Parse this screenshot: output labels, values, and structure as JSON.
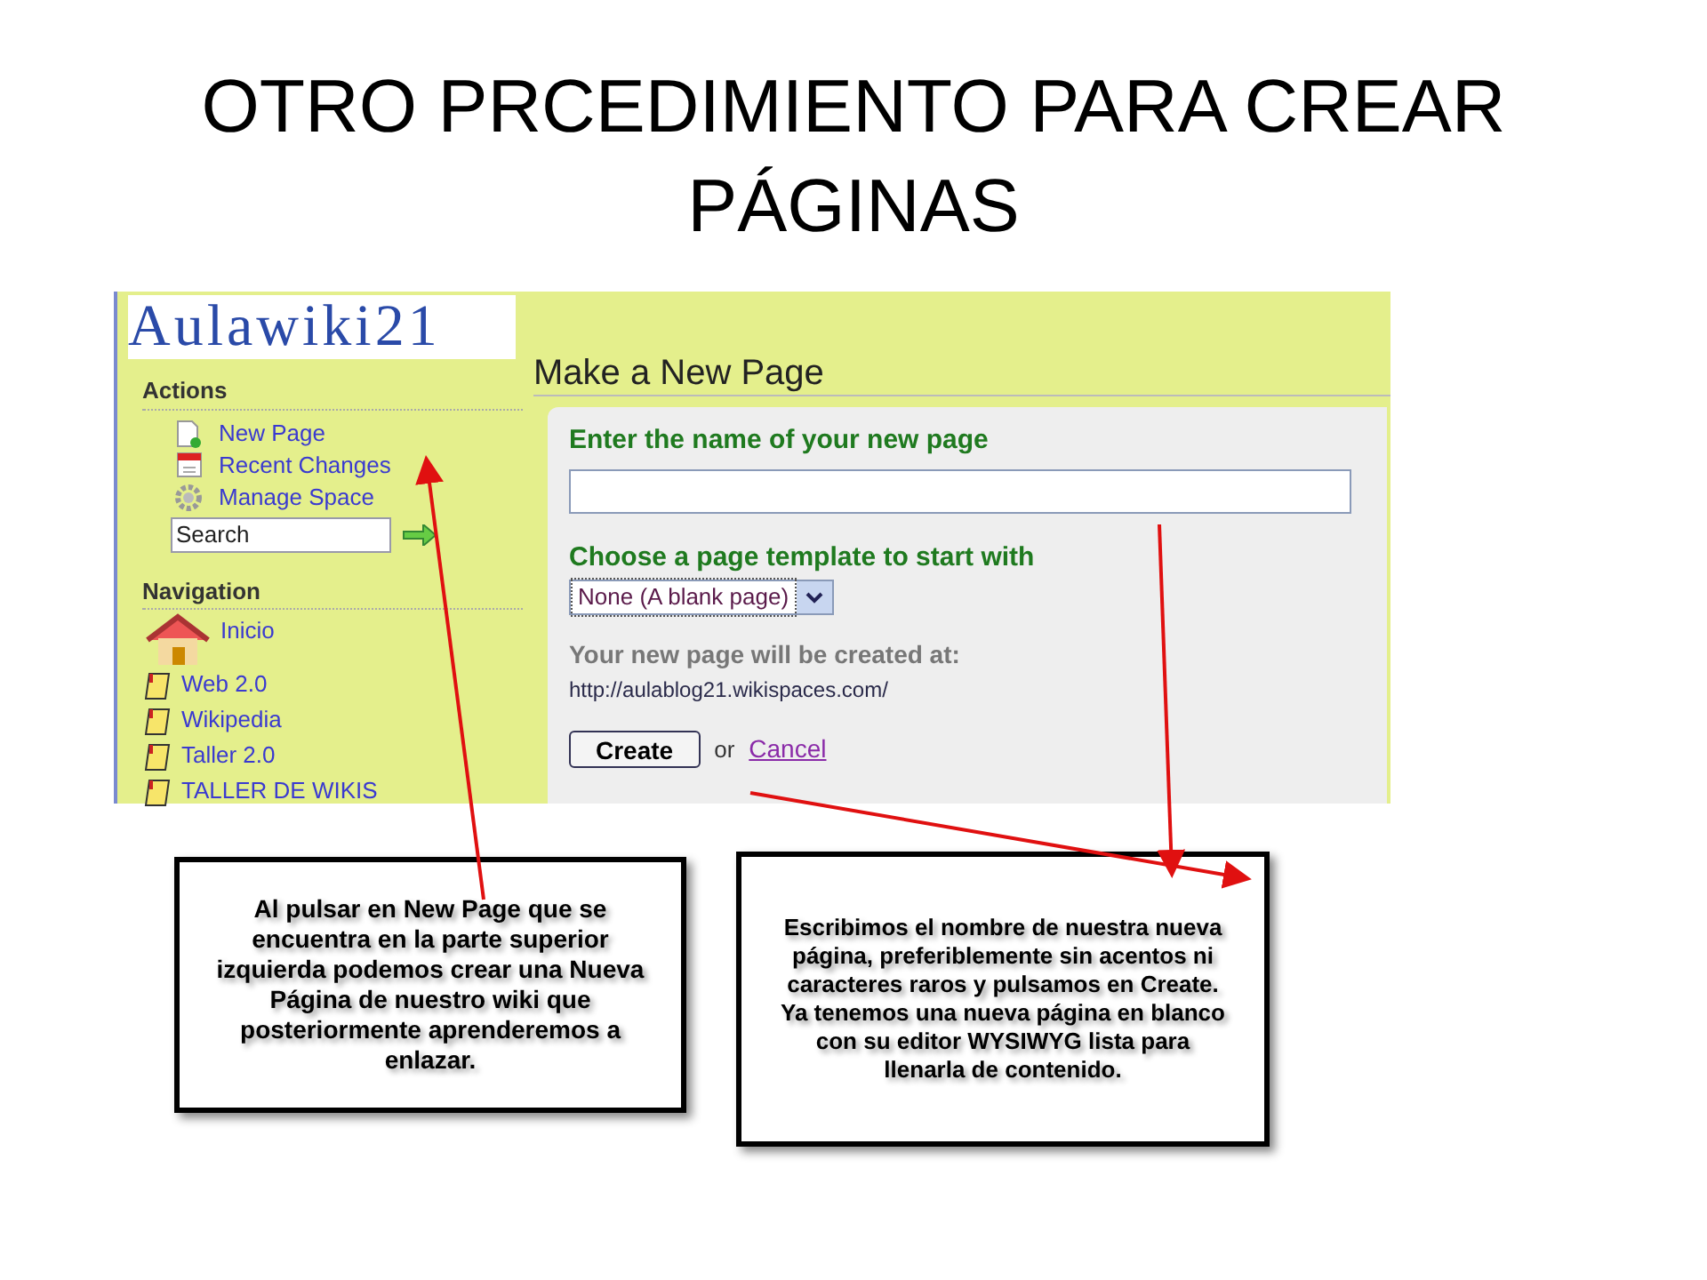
{
  "slide": {
    "title": "OTRO PRCEDIMIENTO PARA CREAR PÁGINAS"
  },
  "screenshot": {
    "logo": "Aulawiki21",
    "sidebar": {
      "actions_heading": "Actions",
      "actions": [
        {
          "label": "New Page",
          "kind": "new-page"
        },
        {
          "label": "Recent Changes",
          "kind": "calendar"
        },
        {
          "label": "Manage Space",
          "kind": "gear"
        }
      ],
      "search": {
        "placeholder": "Search"
      },
      "navigation_heading": "Navigation",
      "navigation": [
        {
          "label": "Inicio",
          "kind": "home"
        },
        {
          "label": "Web 2.0",
          "kind": "page"
        },
        {
          "label": "Wikipedia",
          "kind": "page"
        },
        {
          "label": "Taller 2.0",
          "kind": "page"
        },
        {
          "label": "TALLER DE WIKIS",
          "kind": "page"
        }
      ]
    },
    "main": {
      "heading": "Make a New Page",
      "name_label": "Enter the name of your new page",
      "template_label": "Choose a page template to start with",
      "template_select": {
        "value": "None (A blank page)"
      },
      "location_label": "Your new page will be created at:",
      "location_url": "http://aulablog21.wikispaces.com/",
      "create_button": "Create",
      "or_text": "or",
      "cancel_link": "Cancel"
    }
  },
  "callouts": [
    {
      "text": "Al pulsar en New Page que se encuentra en la parte superior izquierda podemos crear una Nueva Página de nuestro wiki que posteriormente aprenderemos a enlazar."
    },
    {
      "text": "Escribimos el nombre de nuestra nueva página, preferiblemente sin acentos ni caracteres raros y pulsamos en Create. Ya tenemos una nueva página en blanco con su editor WYSIWYG lista para llenarla de contenido."
    }
  ]
}
